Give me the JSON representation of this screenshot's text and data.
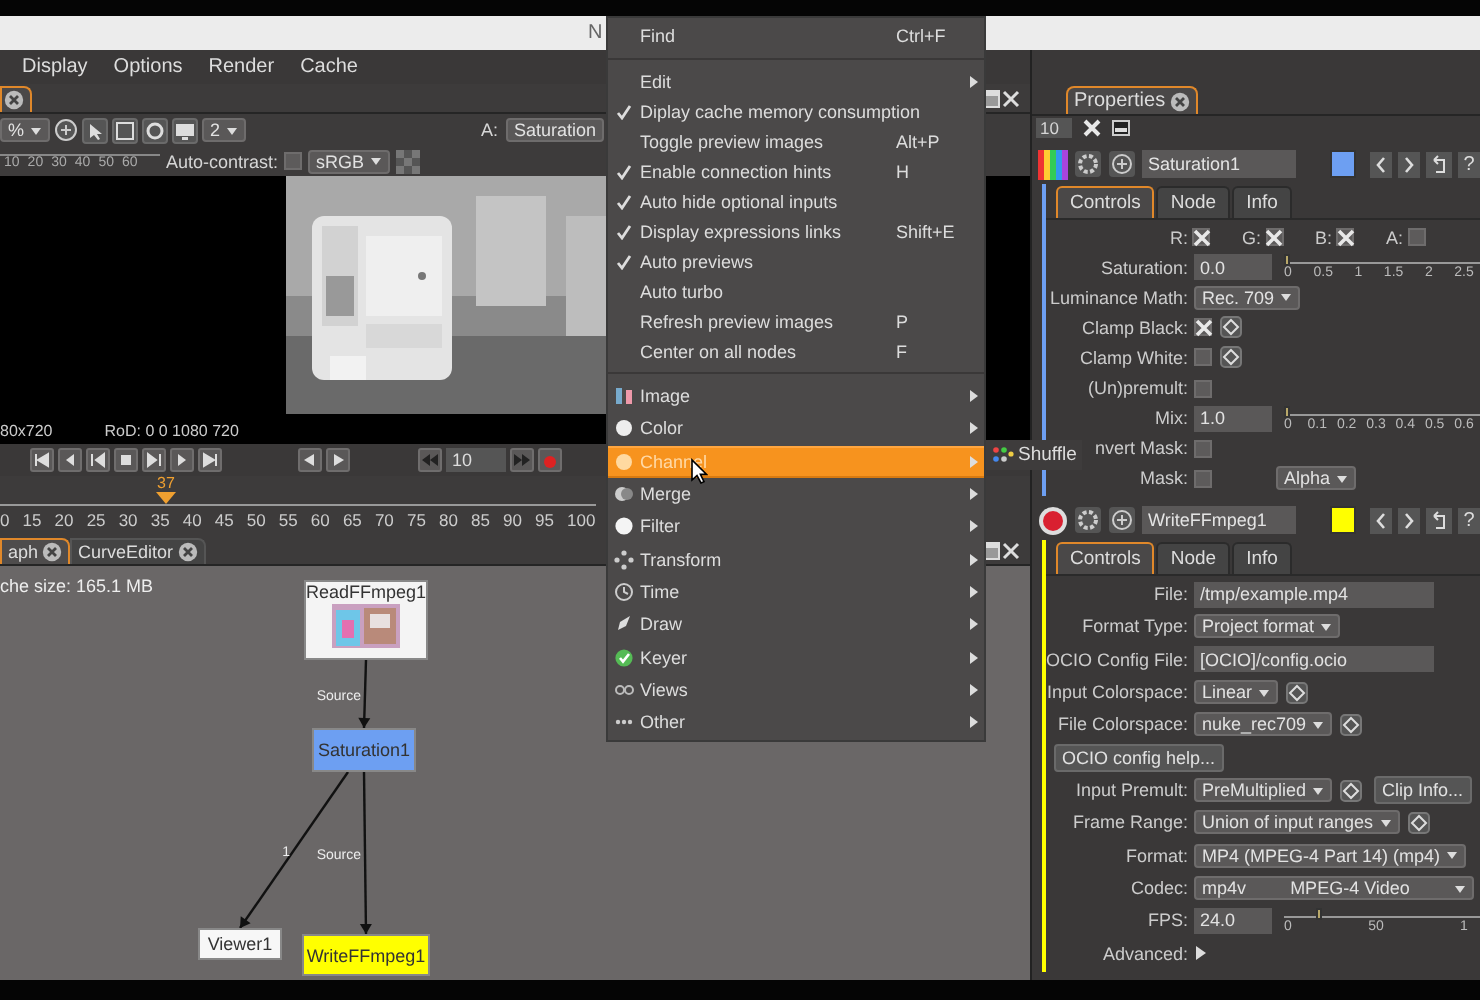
{
  "title_bar": {
    "title": "N"
  },
  "menu_bar": [
    "Display",
    "Options",
    "Render",
    "Cache"
  ],
  "viewer": {
    "zoom": "%",
    "mipmap": "2",
    "input_label": "A:",
    "input": "Saturation",
    "ruler": [
      "10",
      "20",
      "30",
      "40",
      "50",
      "60"
    ],
    "auto_contrast_label": "Auto-contrast:",
    "auto_contrast": false,
    "colorspace": "sRGB",
    "format": "80x720",
    "rod": "RoD: 0 0 1080 720",
    "frame_step": "10",
    "playhead": "37",
    "timeline": [
      "0",
      "15",
      "20",
      "25",
      "30",
      "35",
      "40",
      "45",
      "50",
      "55",
      "60",
      "65",
      "70",
      "75",
      "80",
      "85",
      "90",
      "95",
      "100"
    ]
  },
  "node_graph": {
    "tabs": [
      {
        "label": "aph",
        "selected": true
      },
      {
        "label": "CurveEditor",
        "selected": false
      }
    ],
    "cache_size": "che size: 165.1 MB",
    "nodes": [
      {
        "label": "ReadFFmpeg1",
        "kind": "read"
      },
      {
        "label": "Saturation1",
        "kind": "effect",
        "color": "#6d9ff2"
      },
      {
        "label": "Viewer1",
        "kind": "viewer"
      },
      {
        "label": "WriteFFmpeg1",
        "kind": "effect",
        "color": "#ffff00"
      }
    ],
    "edges": [
      {
        "label": "Source"
      },
      {
        "label": "1"
      },
      {
        "label": "Source"
      }
    ]
  },
  "context_menu": {
    "items": [
      {
        "kind": "action",
        "label": "Find",
        "shortcut": "Ctrl+F"
      },
      {
        "kind": "separator"
      },
      {
        "kind": "submenu",
        "label": "Edit"
      },
      {
        "kind": "toggle",
        "label": "Diplay cache memory consumption",
        "checked": true
      },
      {
        "kind": "toggle",
        "label": "Toggle preview images",
        "checked": false,
        "shortcut": "Alt+P"
      },
      {
        "kind": "toggle",
        "label": "Enable connection hints",
        "checked": true,
        "shortcut": "H"
      },
      {
        "kind": "toggle",
        "label": "Auto hide optional inputs",
        "checked": true
      },
      {
        "kind": "toggle",
        "label": "Display expressions links",
        "checked": true,
        "shortcut": "Shift+E"
      },
      {
        "kind": "toggle",
        "label": "Auto previews",
        "checked": true
      },
      {
        "kind": "toggle",
        "label": "Auto turbo",
        "checked": false
      },
      {
        "kind": "action",
        "label": "Refresh preview images",
        "shortcut": "P"
      },
      {
        "kind": "action",
        "label": "Center on all nodes",
        "shortcut": "F"
      },
      {
        "kind": "separator"
      },
      {
        "kind": "category",
        "label": "Image",
        "selected": false
      },
      {
        "kind": "category",
        "label": "Color",
        "selected": false
      },
      {
        "kind": "category",
        "label": "Channel",
        "selected": true
      },
      {
        "kind": "category",
        "label": "Merge",
        "selected": false
      },
      {
        "kind": "category",
        "label": "Filter",
        "selected": false
      },
      {
        "kind": "category",
        "label": "Transform",
        "selected": false
      },
      {
        "kind": "category",
        "label": "Time",
        "selected": false
      },
      {
        "kind": "category",
        "label": "Draw",
        "selected": false
      },
      {
        "kind": "category",
        "label": "Keyer",
        "selected": false
      },
      {
        "kind": "category",
        "label": "Views",
        "selected": false
      },
      {
        "kind": "category",
        "label": "Other",
        "selected": false
      }
    ],
    "submenu": {
      "label": "Shuffle"
    }
  },
  "properties": {
    "tab": "Properties",
    "max_panels": "10",
    "panels": [
      {
        "name": "Saturation1",
        "kind": "effect",
        "color": "#6d9ff2",
        "help": "?",
        "tabs": [
          {
            "label": "Controls",
            "selected": true
          },
          {
            "label": "Node",
            "selected": false
          },
          {
            "label": "Info",
            "selected": false
          }
        ],
        "params": [
          {
            "kind": "channels",
            "items": [
              {
                "label": "R:",
                "checked": true
              },
              {
                "label": "G:",
                "checked": true
              },
              {
                "label": "B:",
                "checked": true
              },
              {
                "label": "A:",
                "checked": false
              }
            ]
          },
          {
            "kind": "slider",
            "label": "Saturation:",
            "value": "0.0",
            "ticks": [
              "0",
              "0.5",
              "1",
              "1.5",
              "2",
              "2.5"
            ],
            "level": 0
          },
          {
            "kind": "dropdown",
            "label": "Luminance Math:",
            "value": "Rec. 709"
          },
          {
            "kind": "checkbox",
            "label": "Clamp Black:",
            "checked": true,
            "keyframe": true
          },
          {
            "kind": "checkbox",
            "label": "Clamp White:",
            "checked": false,
            "keyframe": true
          },
          {
            "kind": "checkbox",
            "label": "(Un)premult:",
            "checked": false
          },
          {
            "kind": "slider",
            "label": "Mix:",
            "value": "1.0",
            "ticks": [
              "0",
              "0.1",
              "0.2",
              "0.3",
              "0.4",
              "0.5",
              "0.6"
            ],
            "level": 0
          },
          {
            "kind": "checkbox",
            "label": "nvert Mask:",
            "checked": false
          },
          {
            "kind": "checkbox",
            "label": "Mask:",
            "checked": false,
            "dropdown": "Alpha"
          }
        ]
      },
      {
        "name": "WriteFFmpeg1",
        "kind": "write",
        "color": "#ffff00",
        "help": "?",
        "tabs": [
          {
            "label": "Controls",
            "selected": true
          },
          {
            "label": "Node",
            "selected": false
          },
          {
            "label": "Info",
            "selected": false
          }
        ],
        "params": [
          {
            "kind": "field",
            "label": "File:",
            "value": "/tmp/example.mp4"
          },
          {
            "kind": "dropdown",
            "label": "Format Type:",
            "value": "Project format"
          },
          {
            "kind": "field",
            "label": "OCIO Config File:",
            "value": "[OCIO]/config.ocio"
          },
          {
            "kind": "dropdown",
            "label": "Input Colorspace:",
            "value": "Linear",
            "keyframe": true
          },
          {
            "kind": "dropdown",
            "label": "File Colorspace:",
            "value": "nuke_rec709",
            "keyframe": true
          },
          {
            "kind": "button",
            "label": "OCIO config help..."
          },
          {
            "kind": "dropdown",
            "label": "Input Premult:",
            "value": "PreMultiplied",
            "keyframe": true,
            "button": "Clip Info..."
          },
          {
            "kind": "dropdown",
            "label": "Frame Range:",
            "value": "Union of input ranges",
            "keyframe": true
          },
          {
            "kind": "dropdown",
            "label": "Format:",
            "value": "MP4 (MPEG-4 Part 14) (mp4)"
          },
          {
            "kind": "codec",
            "label": "Codec:",
            "value": "mp4v",
            "description": "MPEG-4 Video"
          },
          {
            "kind": "slider",
            "label": "FPS:",
            "value": "24.0",
            "ticks": [
              "0",
              "50",
              "1"
            ],
            "level": 0.17
          },
          {
            "kind": "group",
            "label": "Advanced:",
            "expanded": false
          }
        ]
      }
    ]
  }
}
